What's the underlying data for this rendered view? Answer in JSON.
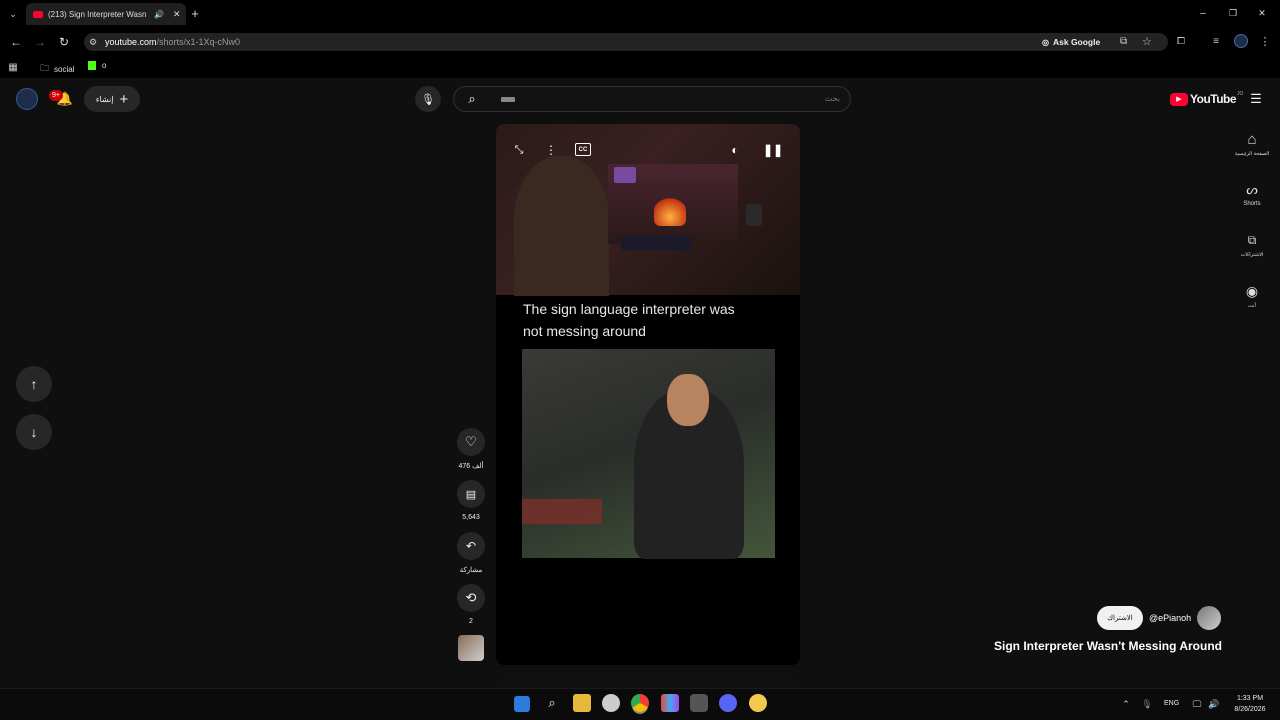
{
  "browser": {
    "tab_title": "(213) Sign Interpreter Wasn",
    "url_host": "youtube.com",
    "url_path": "/shorts/x1-1Xq-cNw0",
    "ask_google": "Ask Google",
    "bookmarks": [
      {
        "label": "social"
      },
      {
        "label": "o"
      }
    ]
  },
  "header": {
    "create_label": "إنشاء",
    "notifications_badge": "9+",
    "search_placeholder": "بحث",
    "logo_text": "YouTube",
    "country_code": "JO"
  },
  "sidebar": {
    "items": [
      {
        "label": "الصفحة الرئيسية",
        "icon": "home-icon"
      },
      {
        "label": "Shorts",
        "icon": "shorts-icon"
      },
      {
        "label": "الاشتراكات",
        "icon": "subscriptions-icon"
      },
      {
        "label": "أنت",
        "icon": "you-icon"
      }
    ]
  },
  "video": {
    "caption_line1": "The sign language interpreter was",
    "caption_line2": "not messing around"
  },
  "actions": {
    "likes": "476 ألف",
    "comments": "5,643",
    "share": "مشاركة",
    "remix": "2"
  },
  "channel": {
    "handle": "@ePianoh",
    "subscribe_label": "الاشتراك",
    "title": "Sign Interpreter Wasn't Messing Around"
  },
  "taskbar": {
    "lang": "ENG",
    "time": "1:33 PM",
    "date": "8/26/2026"
  },
  "colors": {
    "youtube_red": "#ff0033",
    "background": "#0f0f0f",
    "button_bg": "#272727"
  }
}
